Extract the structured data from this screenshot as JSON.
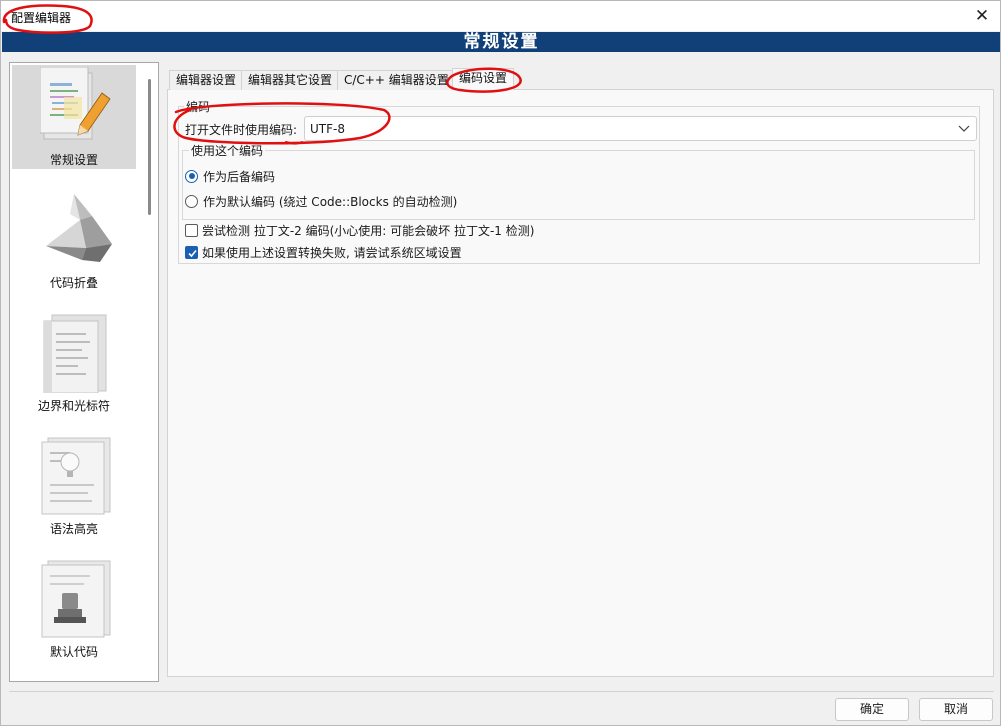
{
  "window": {
    "title": "配置编辑器",
    "close_glyph": "✕",
    "banner_title": "常规设置"
  },
  "sidebar": {
    "items": [
      {
        "label": "常规设置",
        "icon": "general-settings-icon",
        "active": true
      },
      {
        "label": "代码折叠",
        "icon": "code-folding-icon",
        "active": false
      },
      {
        "label": "边界和光标符",
        "icon": "margins-caret-icon",
        "active": false
      },
      {
        "label": "语法高亮",
        "icon": "syntax-highlight-icon",
        "active": false
      },
      {
        "label": "默认代码",
        "icon": "default-code-icon",
        "active": false
      }
    ]
  },
  "tabs": [
    {
      "label": "编辑器设置",
      "active": false
    },
    {
      "label": "编辑器其它设置",
      "active": false
    },
    {
      "label": "C/C++ 编辑器设置",
      "active": false
    },
    {
      "label": "编码设置",
      "active": true
    }
  ],
  "encoding": {
    "group_title": "编码",
    "open_label": "打开文件时使用编码:",
    "selected_encoding": "UTF-8",
    "use_group_title": "使用这个编码",
    "radio_fallback": "作为后备编码",
    "radio_default": "作为默认编码 (绕过 Code::Blocks 的自动检测)",
    "radio_selected": "fallback",
    "latin2_check": "尝试检测 拉丁文-2 编码(小心使用: 可能会破坏 拉丁文-1 检测)",
    "latin2_checked": false,
    "locale_check": "如果使用上述设置转换失败, 请尝试系统区域设置",
    "locale_checked": true
  },
  "footer": {
    "ok_label": "确定",
    "cancel_label": "取消"
  },
  "colors": {
    "banner": "#113f78",
    "accent": "#1a5fb4",
    "annotation": "#e01010"
  }
}
